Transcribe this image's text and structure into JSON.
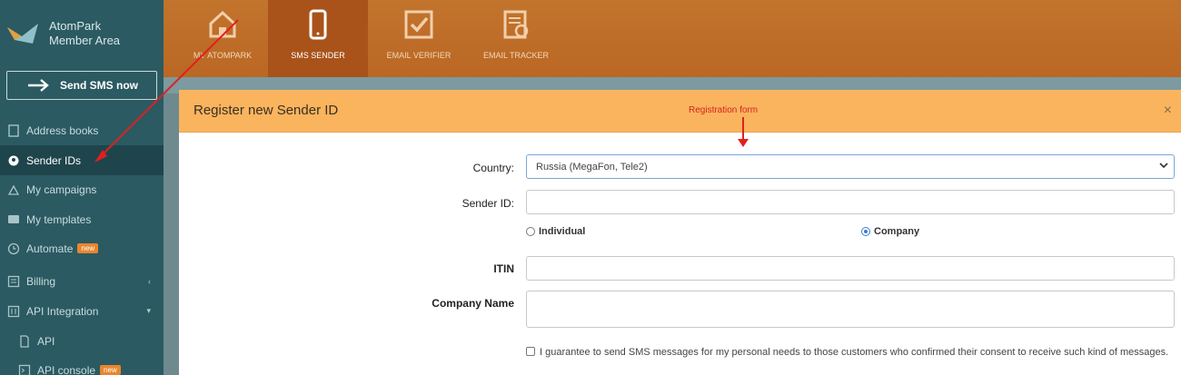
{
  "brand": {
    "line1": "AtomPark",
    "line2": "Member Area"
  },
  "send_button": "Send SMS now",
  "sidebar": {
    "items": [
      {
        "label": "Address books",
        "icon": "book-icon"
      },
      {
        "label": "Sender IDs",
        "icon": "sender-id-icon",
        "active": true
      },
      {
        "label": "My campaigns",
        "icon": "campaign-icon"
      },
      {
        "label": "My templates",
        "icon": "template-icon"
      },
      {
        "label": "Automate",
        "icon": "clock-icon",
        "badge": "new"
      },
      {
        "label": "Billing",
        "icon": "billing-icon",
        "chevron": "‹"
      },
      {
        "label": "API Integration",
        "icon": "api-icon",
        "chevron": "▾"
      },
      {
        "label": "API",
        "icon": "file-icon"
      },
      {
        "label": "API console",
        "icon": "console-icon",
        "badge": "new"
      }
    ]
  },
  "top_tabs": [
    {
      "label": "MY ATOMPARK",
      "icon": "home-icon"
    },
    {
      "label": "SMS SENDER",
      "icon": "phone-icon",
      "active": true
    },
    {
      "label": "EMAIL VERIFIER",
      "icon": "check-icon"
    },
    {
      "label": "EMAIL TRACKER",
      "icon": "tracker-icon"
    }
  ],
  "modal": {
    "title": "Register new Sender ID",
    "close": "×",
    "annotation": "Registration form",
    "country_label": "Country:",
    "country_value": "Russia (MegaFon, Tele2)",
    "sender_label": "Sender ID:",
    "radio_individual": "Individual",
    "radio_company": "Company",
    "itin_label": "ITIN",
    "company_label": "Company Name",
    "guarantee_text": "I guarantee to send SMS messages for my personal needs to those customers who confirmed their consent to receive such kind of messages."
  },
  "colors": {
    "sidebar_bg": "#2b5a62",
    "topbar": "#c2742d",
    "modal_header": "#fab45e",
    "annotation": "#d62222"
  }
}
